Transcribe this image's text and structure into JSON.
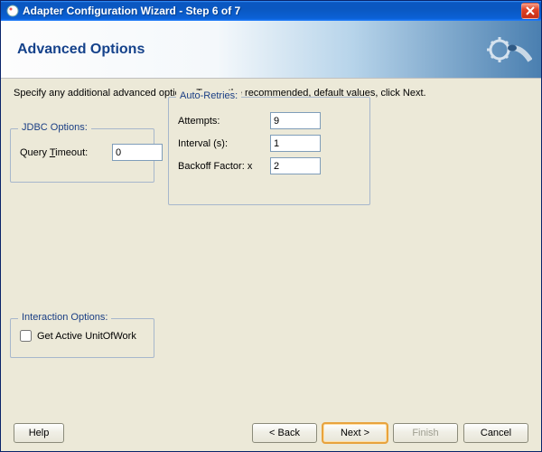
{
  "title": "Adapter Configuration Wizard - Step 6 of 7",
  "header": {
    "pagetitle": "Advanced Options"
  },
  "instruction": "Specify any additional advanced options.  To use the recommended, default values, click Next.",
  "jdbc": {
    "legend": "JDBC Options:",
    "query_timeout_label_pre": "Query ",
    "query_timeout_label_u": "T",
    "query_timeout_label_post": "imeout:",
    "query_timeout_value": "0"
  },
  "auto": {
    "legend": "Auto-Retries:",
    "attempts_label": "Attempts:",
    "attempts_value": "9",
    "interval_label": "Interval (s):",
    "interval_value": "1",
    "backoff_label": "Backoff Factor: x",
    "backoff_value": "2"
  },
  "interact": {
    "legend": "Interaction Options:",
    "get_active_label": "Get Active UnitOfWork"
  },
  "buttons": {
    "help": "Help",
    "back": "< Back",
    "next": "Next >",
    "finish": "Finish",
    "cancel": "Cancel"
  }
}
